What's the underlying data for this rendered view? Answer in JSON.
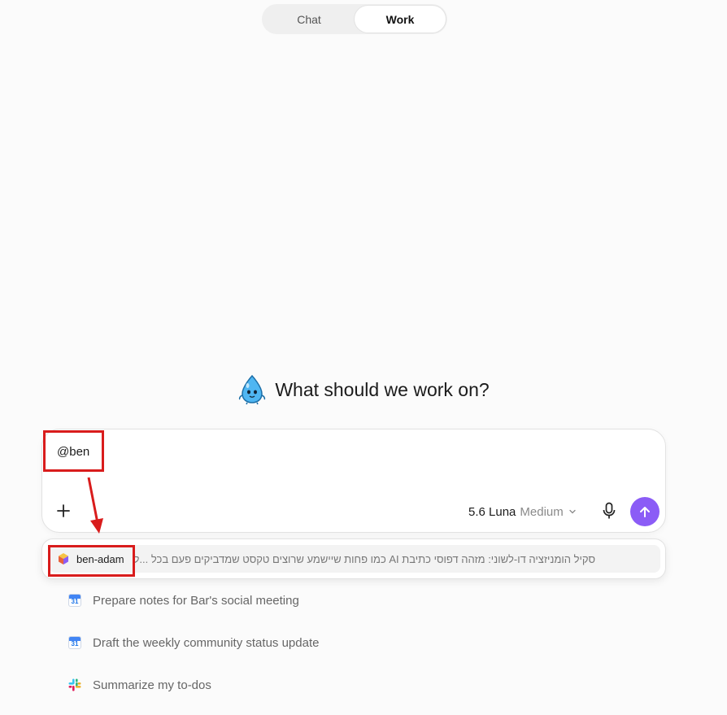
{
  "mode_toggle": {
    "tabs": [
      {
        "label": "Chat",
        "active": false
      },
      {
        "label": "Work",
        "active": true
      }
    ]
  },
  "hero": {
    "title": "What should we work on?",
    "mascot_icon": "water-drop-mascot-icon"
  },
  "composer": {
    "value": "@ben",
    "add_icon": "plus-icon",
    "model": {
      "name": "5.6 Luna",
      "effort": "Medium"
    },
    "mic_icon": "microphone-icon",
    "send_icon": "arrow-up-icon",
    "send_color": "#8b5cf6"
  },
  "mention_dropdown": {
    "items": [
      {
        "name": "ben-adam",
        "icon": "cube-icon",
        "description": "סקיל הומניזציה דו-לשוני: מזהה דפוסי כתיבת AI כמו פחות שיישמע שרוצים טקסט שמדביקים פעם בכל ...ל"
      }
    ]
  },
  "suggestions": [
    {
      "label": "Prepare notes for Bar's social meeting",
      "icon": "calendar-icon",
      "icon_text": "31"
    },
    {
      "label": "Draft the weekly community status update",
      "icon": "calendar-icon",
      "icon_text": "31"
    },
    {
      "label": "Summarize my to-dos",
      "icon": "slack-icon"
    }
  ],
  "annotation_color": "#d91c1c"
}
